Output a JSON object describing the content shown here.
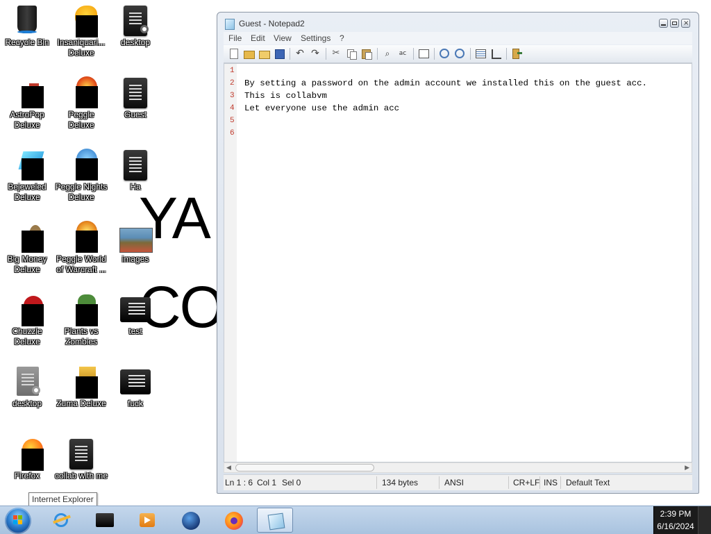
{
  "desktop": {
    "wallpaper_text": [
      "YA",
      "CO"
    ],
    "icons": [
      {
        "label": "Recycle Bin",
        "icon": "recycle-bin-icon"
      },
      {
        "label": "Insaniquari... Deluxe",
        "icon": "insaniquarium-icon"
      },
      {
        "label": "desktop",
        "icon": "document-icon"
      },
      {
        "label": "AstroPop Deluxe",
        "icon": "astropop-icon"
      },
      {
        "label": "Peggle Deluxe",
        "icon": "peggle-icon"
      },
      {
        "label": "Guest",
        "icon": "document-icon"
      },
      {
        "label": "Bejeweled Deluxe",
        "icon": "bejeweled-icon"
      },
      {
        "label": "Peggle Nights Deluxe",
        "icon": "peggle-nights-icon"
      },
      {
        "label": "Ha",
        "icon": "document-icon"
      },
      {
        "label": "Big Money Deluxe",
        "icon": "big-money-icon"
      },
      {
        "label": "Peggle World of Warcraft ...",
        "icon": "peggle-wow-icon"
      },
      {
        "label": "images",
        "icon": "image-file-icon"
      },
      {
        "label": "Chuzzle Deluxe",
        "icon": "chuzzle-icon"
      },
      {
        "label": "Plants vs Zombies",
        "icon": "plants-vs-zombies-icon"
      },
      {
        "label": "test",
        "icon": "text-file-icon"
      },
      {
        "label": "desktop",
        "icon": "document-icon"
      },
      {
        "label": "Zuma Deluxe",
        "icon": "zuma-icon"
      },
      {
        "label": "fuck",
        "icon": "text-file-icon"
      },
      {
        "label": "Firefox",
        "icon": "firefox-icon"
      },
      {
        "label": "collab with me",
        "icon": "document-icon"
      }
    ]
  },
  "window": {
    "title": "Guest - Notepad2",
    "menu": [
      "File",
      "Edit",
      "View",
      "Settings",
      "?"
    ],
    "toolbar_icons": [
      "new-file-icon",
      "open-file-icon",
      "browse-icon",
      "save-icon",
      "undo-icon",
      "redo-icon",
      "cut-icon",
      "copy-icon",
      "paste-icon",
      "find-icon",
      "replace-icon",
      "word-wrap-icon",
      "zoom-in-icon",
      "zoom-out-icon",
      "scheme-icon",
      "customize-icon",
      "exit-icon"
    ],
    "lines": [
      {
        "num": "1",
        "text": ""
      },
      {
        "num": "2",
        "text": "By setting a password on the admin account we installed this on the guest acc."
      },
      {
        "num": "3",
        "text": "This is collabvm"
      },
      {
        "num": "4",
        "text": "Let everyone use the admin acc"
      },
      {
        "num": "5",
        "text": ""
      },
      {
        "num": "6",
        "text": ""
      }
    ],
    "status": {
      "position": "Ln 1 : 6",
      "col": "Col 1",
      "sel": "Sel 0",
      "size": "134 bytes",
      "encoding": "ANSI",
      "line_ending": "CR+LF",
      "mode": "INS",
      "scheme": "Default Text"
    }
  },
  "tooltip": "Internet Explorer",
  "taskbar": {
    "apps": [
      "internet-explorer-icon",
      "cmd-icon",
      "media-player-icon",
      "globe-icon",
      "firefox-icon",
      "notepad2-icon"
    ],
    "time": "2:39 PM",
    "date": "6/16/2024"
  }
}
